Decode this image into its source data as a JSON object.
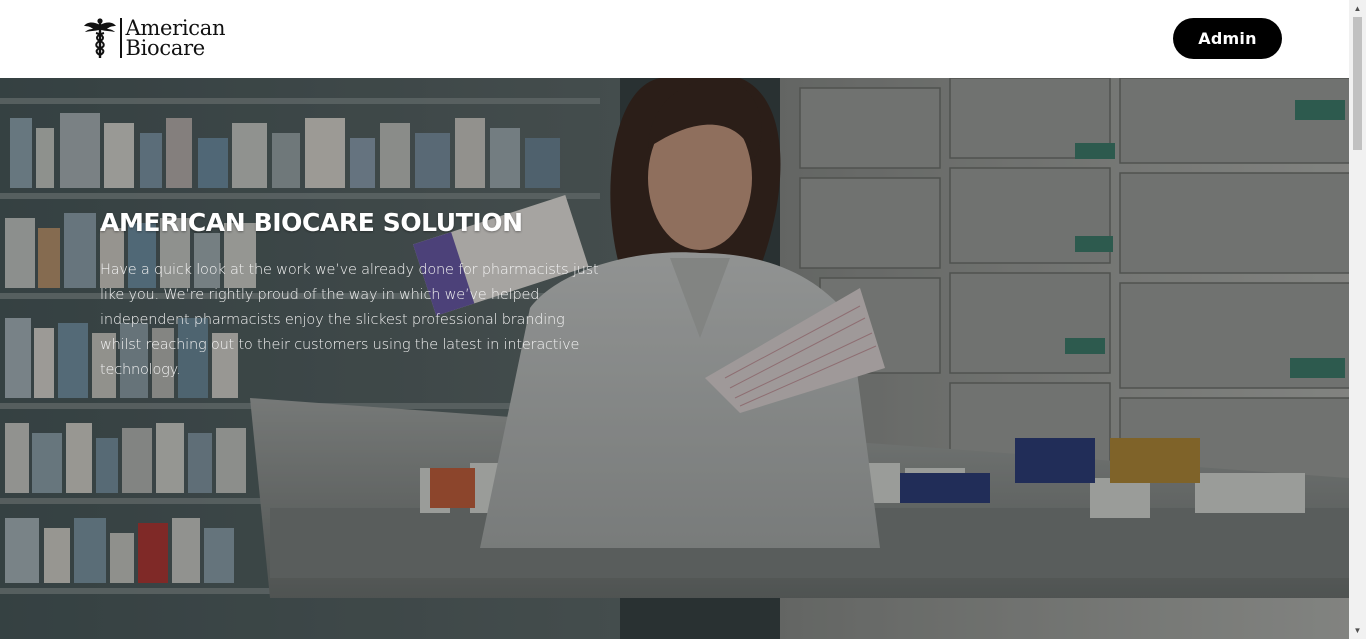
{
  "header": {
    "logo": {
      "line1": "American",
      "line2": "Biocare",
      "icon": "caduceus-icon"
    },
    "admin_label": "Admin"
  },
  "hero": {
    "title": "AMERICAN BIOCARE SOLUTION",
    "description": "Have a quick look at the work we’ve already done for pharmacists just like you. We’re rightly proud of the way in which we’ve helped independent pharmacists enjoy the slickest professional branding whilst reaching out to their customers using the latest in interactive technology.",
    "image": "pharmacist-photo"
  },
  "scrollbar": {
    "up_icon": "triangle-up-icon",
    "down_icon": "triangle-down-icon"
  }
}
